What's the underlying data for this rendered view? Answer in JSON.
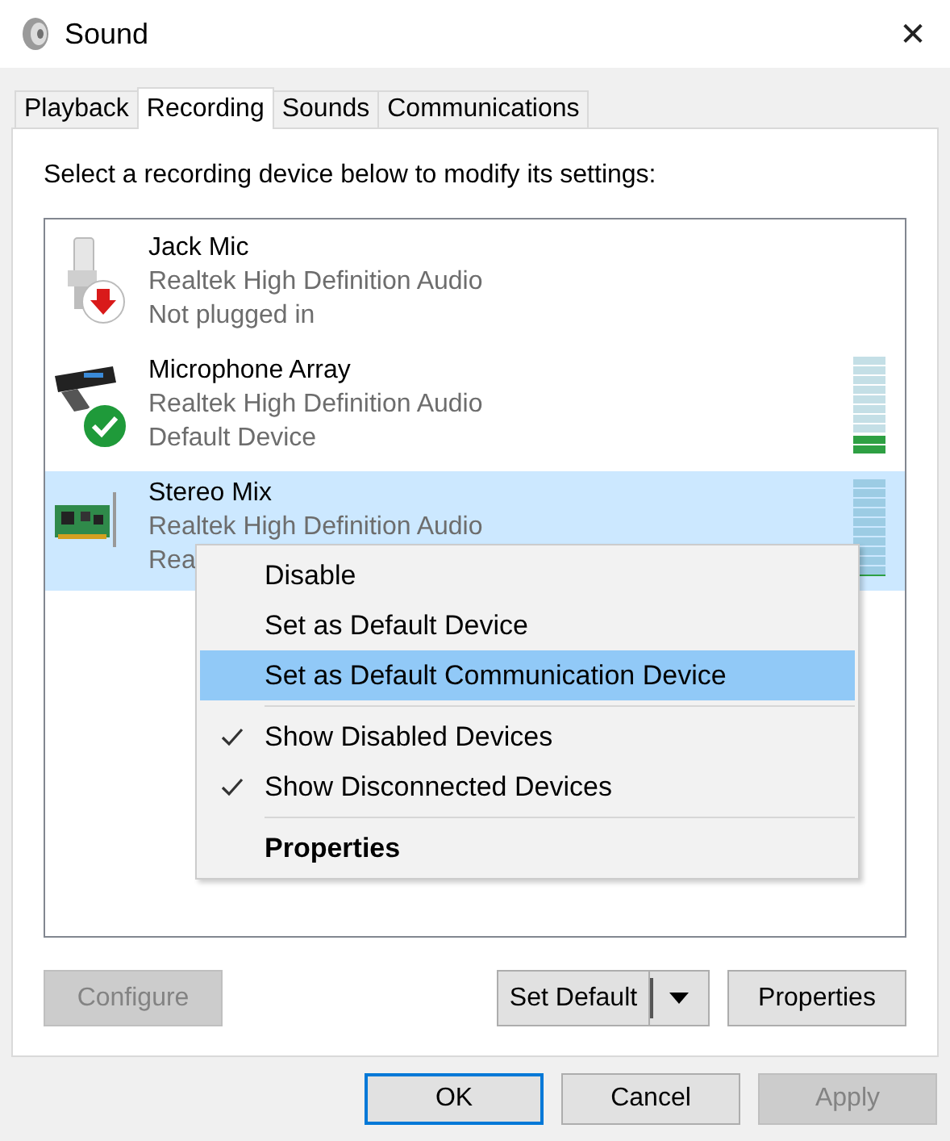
{
  "window": {
    "title": "Sound",
    "close": "✕"
  },
  "tabs": [
    {
      "label": "Playback",
      "selected": false
    },
    {
      "label": "Recording",
      "selected": true
    },
    {
      "label": "Sounds",
      "selected": false
    },
    {
      "label": "Communications",
      "selected": false
    }
  ],
  "instruction": "Select a recording device below to modify its settings:",
  "devices": [
    {
      "kind": "jack",
      "unplugged": true,
      "is_default": false,
      "name": "Jack Mic",
      "driver": "Realtek High Definition Audio",
      "status": "Not plugged in",
      "selected": false
    },
    {
      "kind": "array",
      "unplugged": false,
      "is_default": true,
      "name": "Microphone Array",
      "driver": "Realtek High Definition Audio",
      "status": "Default Device",
      "selected": false,
      "level": 0.2
    },
    {
      "kind": "card",
      "unplugged": false,
      "is_default": false,
      "name": "Stereo Mix",
      "driver": "Realtek High Definition Audio",
      "status": "Rea",
      "selected": true,
      "level": 0
    }
  ],
  "context_menu": {
    "groups": [
      [
        {
          "label": "Disable",
          "checked": false,
          "selected": false,
          "default": false
        },
        {
          "label": "Set as Default Device",
          "checked": false,
          "selected": false,
          "default": false
        },
        {
          "label": "Set as Default Communication Device",
          "checked": false,
          "selected": true,
          "default": false
        }
      ],
      [
        {
          "label": "Show Disabled Devices",
          "checked": true,
          "selected": false,
          "default": false
        },
        {
          "label": "Show Disconnected Devices",
          "checked": true,
          "selected": false,
          "default": false
        }
      ],
      [
        {
          "label": "Properties",
          "checked": false,
          "selected": false,
          "default": true
        }
      ]
    ]
  },
  "panel_buttons": {
    "configure": {
      "label": "Configure",
      "disabled": true
    },
    "set_default": {
      "label": "Set Default",
      "disabled": false
    },
    "properties": {
      "label": "Properties",
      "disabled": false
    }
  },
  "dialog_buttons": [
    {
      "label": "OK",
      "disabled": false,
      "focused": true
    },
    {
      "label": "Cancel",
      "disabled": false,
      "focused": false
    },
    {
      "label": "Apply",
      "disabled": true,
      "focused": false
    }
  ]
}
